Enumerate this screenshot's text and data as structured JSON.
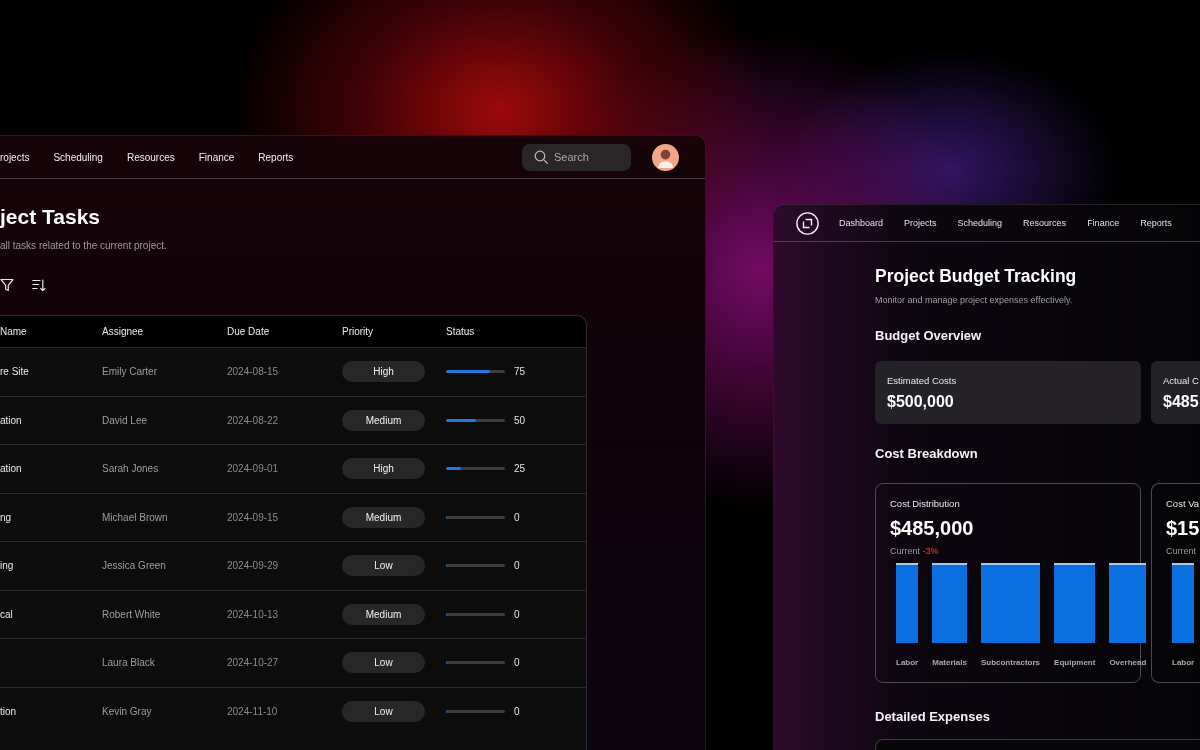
{
  "left_window": {
    "nav": {
      "items": [
        {
          "label": "rojects"
        },
        {
          "label": "Scheduling"
        },
        {
          "label": "Resources"
        },
        {
          "label": "Finance"
        },
        {
          "label": "Reports"
        }
      ]
    },
    "search": {
      "placeholder": "Search"
    },
    "page": {
      "title": "ject Tasks",
      "subtitle": "all tasks related to the current project."
    },
    "table": {
      "columns": [
        "Name",
        "Assignee",
        "Due Date",
        "Priority",
        "Status"
      ],
      "rows": [
        {
          "name": "re Site",
          "assignee": "Emily Carter",
          "due_date": "2024-08-15",
          "priority": "High",
          "level": 0.75,
          "status": "75"
        },
        {
          "name": "ation",
          "assignee": "David Lee",
          "due_date": "2024-08-22",
          "priority": "Medium",
          "level": 0.5,
          "status": "50"
        },
        {
          "name": "ation",
          "assignee": "Sarah Jones",
          "due_date": "2024-09-01",
          "priority": "High",
          "level": 0.25,
          "status": "25"
        },
        {
          "name": "ng",
          "assignee": "Michael Brown",
          "due_date": "2024-09-15",
          "priority": "Medium",
          "level": 0,
          "status": "0"
        },
        {
          "name": "ing",
          "assignee": "Jessica Green",
          "due_date": "2024-09-29",
          "priority": "Low",
          "level": 0,
          "status": "0"
        },
        {
          "name": "cal",
          "assignee": "Robert White",
          "due_date": "2024-10-13",
          "priority": "Medium",
          "level": 0,
          "status": "0"
        },
        {
          "assignee": "Laura Black",
          "due_date": "2024-10-27",
          "priority": "Low",
          "level": 0,
          "status": "0"
        },
        {
          "name": "tion",
          "assignee": "Kevin Gray",
          "due_date": "2024-11-10",
          "priority": "Low",
          "level": 0,
          "status": "0"
        }
      ]
    }
  },
  "right_window": {
    "nav": {
      "items": [
        {
          "label": "Dashboard"
        },
        {
          "label": "Projects"
        },
        {
          "label": "Scheduling"
        },
        {
          "label": "Resources"
        },
        {
          "label": "Finance"
        },
        {
          "label": "Reports"
        }
      ]
    },
    "title": "Project Budget Tracking",
    "subtitle": "Monitor and manage project expenses effectively.",
    "overview": {
      "heading": "Budget Overview",
      "cards": [
        {
          "label": "Estimated Costs",
          "value": "$500,000"
        },
        {
          "label": "Actual C",
          "value": "$485"
        }
      ]
    },
    "breakdown": {
      "heading": "Cost Breakdown",
      "charts": [
        {
          "title": "Cost Distribution",
          "value": "$485,000",
          "note": "Current",
          "change": "-3%",
          "bars": [
            "Labor",
            "Materials",
            "Subcontractors",
            "Equipment",
            "Overhead"
          ]
        },
        {
          "title": "Cost Va",
          "value": "$15",
          "note": "Current",
          "bars": [
            "Labor"
          ]
        }
      ]
    },
    "expenses": {
      "heading": "Detailed Expenses"
    }
  }
}
